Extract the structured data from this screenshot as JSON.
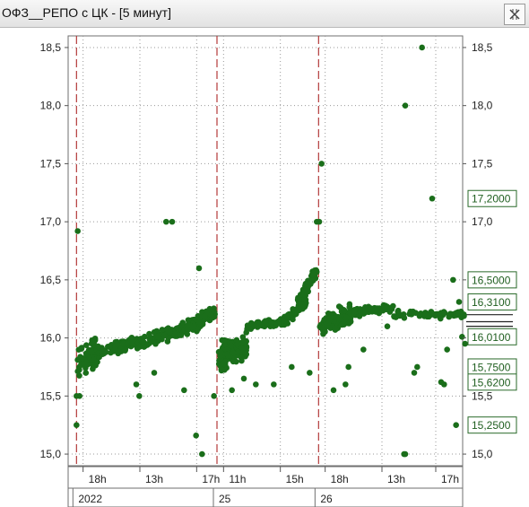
{
  "window": {
    "title": "ОФЗ__РЕПО с ЦК - [5 минут]",
    "pin_icon": "pin-close-icon"
  },
  "chart_data": {
    "type": "scatter",
    "title": "",
    "xlabel": "",
    "ylabel": "",
    "ylim": [
      14.9,
      18.6
    ],
    "grid": true,
    "marker_color": "#1a6e1a",
    "divider_color": "#b33a3a",
    "y_ticks": [
      "15,0",
      "15,5",
      "16,0",
      "16,5",
      "17,0",
      "17,5",
      "18,0",
      "18,5"
    ],
    "y_tick_values": [
      15.0,
      15.5,
      16.0,
      16.5,
      17.0,
      17.5,
      18.0,
      18.5
    ],
    "x_tick_labels": [
      "18h",
      "13h",
      "17h",
      "11h",
      "15h",
      "18h",
      "13h",
      "17h"
    ],
    "x_tick_hours": [
      0.2,
      1.15,
      2.1,
      2.55,
      3.5,
      4.25,
      5.2,
      6.1
    ],
    "date_labels": [
      {
        "text": "2022",
        "at": 0.0
      },
      {
        "text": "25",
        "at": 2.35
      },
      {
        "text": "26",
        "at": 4.05
      }
    ],
    "session_dividers": [
      0.0,
      2.35,
      4.05
    ],
    "x_range": [
      -0.05,
      6.55
    ],
    "price_boxes": [
      {
        "text": "17,2000",
        "value": 17.2
      },
      {
        "text": "16,5000",
        "value": 16.5
      },
      {
        "text": "16,3100",
        "value": 16.31
      },
      {
        "text": "16,0100",
        "value": 16.01
      },
      {
        "text": "15,7500",
        "value": 15.75
      },
      {
        "text": "15,6200",
        "value": 15.62
      },
      {
        "text": "15,2500",
        "value": 15.25
      }
    ],
    "extra_levels": [
      16.2,
      16.14,
      16.1
    ],
    "series": [
      {
        "segments": [
          {
            "x0": 0.02,
            "x1": 0.35,
            "y0": 15.82,
            "y1": 15.85,
            "n": 90,
            "spread": 0.17
          },
          {
            "x0": 0.35,
            "x1": 1.05,
            "y0": 15.88,
            "y1": 15.97,
            "n": 80,
            "spread": 0.07
          },
          {
            "x0": 1.05,
            "x1": 1.75,
            "y0": 15.96,
            "y1": 16.06,
            "n": 80,
            "spread": 0.07
          },
          {
            "x0": 1.75,
            "x1": 2.32,
            "y0": 16.05,
            "y1": 16.22,
            "n": 80,
            "spread": 0.09
          },
          {
            "x0": 2.37,
            "x1": 2.85,
            "y0": 15.82,
            "y1": 15.92,
            "n": 120,
            "spread": 0.17
          },
          {
            "x0": 2.85,
            "x1": 3.45,
            "y0": 16.1,
            "y1": 16.14,
            "n": 70,
            "spread": 0.04
          },
          {
            "x0": 3.45,
            "x1": 3.85,
            "y0": 16.14,
            "y1": 16.3,
            "n": 60,
            "spread": 0.07
          },
          {
            "x0": 3.7,
            "x1": 4.02,
            "y0": 16.3,
            "y1": 16.58,
            "n": 70,
            "spread": 0.08
          },
          {
            "x0": 4.07,
            "x1": 4.6,
            "y0": 16.1,
            "y1": 16.2,
            "n": 100,
            "spread": 0.12
          },
          {
            "x0": 4.6,
            "x1": 5.3,
            "y0": 16.22,
            "y1": 16.27,
            "n": 60,
            "spread": 0.05
          },
          {
            "x0": 5.3,
            "x1": 6.5,
            "y0": 16.2,
            "y1": 16.2,
            "n": 70,
            "spread": 0.05
          }
        ],
        "outliers": [
          [
            0.02,
            16.92
          ],
          [
            0.0,
            15.25
          ],
          [
            0.0,
            15.5
          ],
          [
            0.05,
            15.5
          ],
          [
            1.5,
            17.0
          ],
          [
            1.6,
            17.0
          ],
          [
            2.05,
            16.6
          ],
          [
            2.0,
            15.16
          ],
          [
            2.1,
            15.0
          ],
          [
            1.05,
            15.5
          ],
          [
            1.0,
            15.6
          ],
          [
            1.3,
            15.7
          ],
          [
            1.8,
            15.55
          ],
          [
            2.3,
            15.5
          ],
          [
            2.6,
            15.55
          ],
          [
            2.8,
            15.65
          ],
          [
            3.0,
            15.6
          ],
          [
            3.3,
            15.6
          ],
          [
            3.6,
            15.75
          ],
          [
            3.9,
            15.7
          ],
          [
            4.02,
            17.0
          ],
          [
            4.1,
            17.5
          ],
          [
            4.06,
            17.0
          ],
          [
            4.3,
            15.55
          ],
          [
            4.5,
            15.6
          ],
          [
            4.55,
            15.75
          ],
          [
            4.8,
            15.9
          ],
          [
            5.2,
            16.1
          ],
          [
            5.48,
            15.0
          ],
          [
            5.5,
            15.0
          ],
          [
            5.65,
            15.7
          ],
          [
            5.7,
            15.75
          ],
          [
            5.78,
            18.5
          ],
          [
            5.5,
            18.0
          ],
          [
            5.95,
            17.2
          ],
          [
            6.3,
            16.5
          ],
          [
            6.35,
            15.25
          ],
          [
            6.15,
            15.6
          ],
          [
            6.1,
            15.62
          ],
          [
            6.4,
            16.31
          ],
          [
            6.45,
            16.01
          ],
          [
            6.2,
            15.9
          ],
          [
            6.5,
            15.95
          ]
        ]
      }
    ]
  }
}
